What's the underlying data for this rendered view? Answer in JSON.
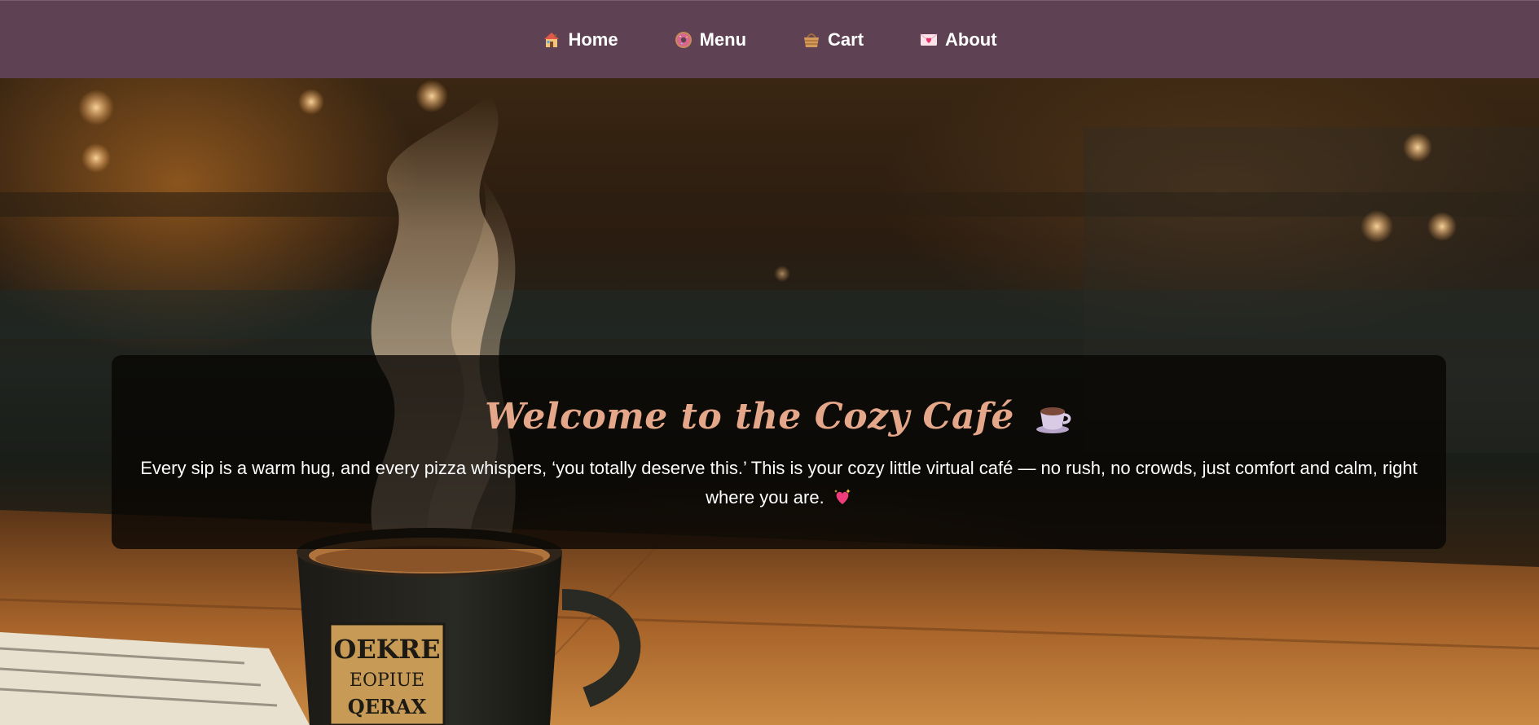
{
  "nav": {
    "items": [
      {
        "label": "Home",
        "icon": "house-icon"
      },
      {
        "label": "Menu",
        "icon": "donut-icon"
      },
      {
        "label": "Cart",
        "icon": "basket-icon"
      },
      {
        "label": "About",
        "icon": "love-letter-icon"
      }
    ],
    "background_color": "#5e4253",
    "text_color": "#ffffff"
  },
  "hero": {
    "title": "Welcome to the Cozy Café",
    "title_icon": "coffee-cup-icon",
    "title_color": "#e5a789",
    "text": "Every sip is a warm hug, and every pizza whispers, ‘you totally deserve this.’ This is your cozy little virtual café — no rush, no crowds, just comfort and calm, right where you are.",
    "text_icon": "sparkling-heart-icon",
    "mug_label": [
      "OEKRE",
      "EOPIUE",
      "QERAX"
    ]
  }
}
